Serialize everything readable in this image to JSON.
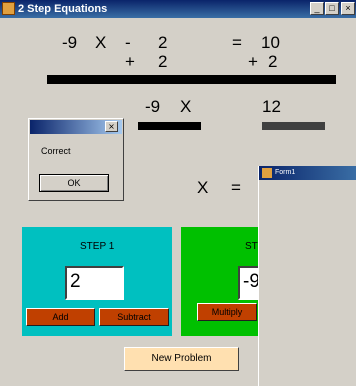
{
  "window": {
    "title": "2 Step Equations",
    "minimize_label": "_",
    "maximize_label": "□",
    "close_label": "×"
  },
  "equation": {
    "row1": {
      "coefficient": "-9",
      "variable": "X",
      "operator": "-",
      "constant": "2",
      "equals": "=",
      "result": "10"
    },
    "row2": {
      "left_op": "+",
      "left_value": "2",
      "right_op": "+",
      "right_value": "2"
    }
  },
  "simplified": {
    "coefficient": "-9",
    "variable": "X",
    "result": "12"
  },
  "solution": {
    "variable": "X",
    "equals": "="
  },
  "step1": {
    "label": "STEP 1",
    "answer": "2",
    "add_label": "Add",
    "subtract_label": "Subtract",
    "color": "#00c0c0"
  },
  "step2": {
    "label": "ST",
    "answer": "-9",
    "multiply_label": "Multiply",
    "color": "#00c000"
  },
  "new_problem_label": "New Problem",
  "dialog": {
    "close_label": "×",
    "message": "Correct",
    "ok_label": "OK"
  },
  "second_window": {
    "title": "Form1"
  }
}
